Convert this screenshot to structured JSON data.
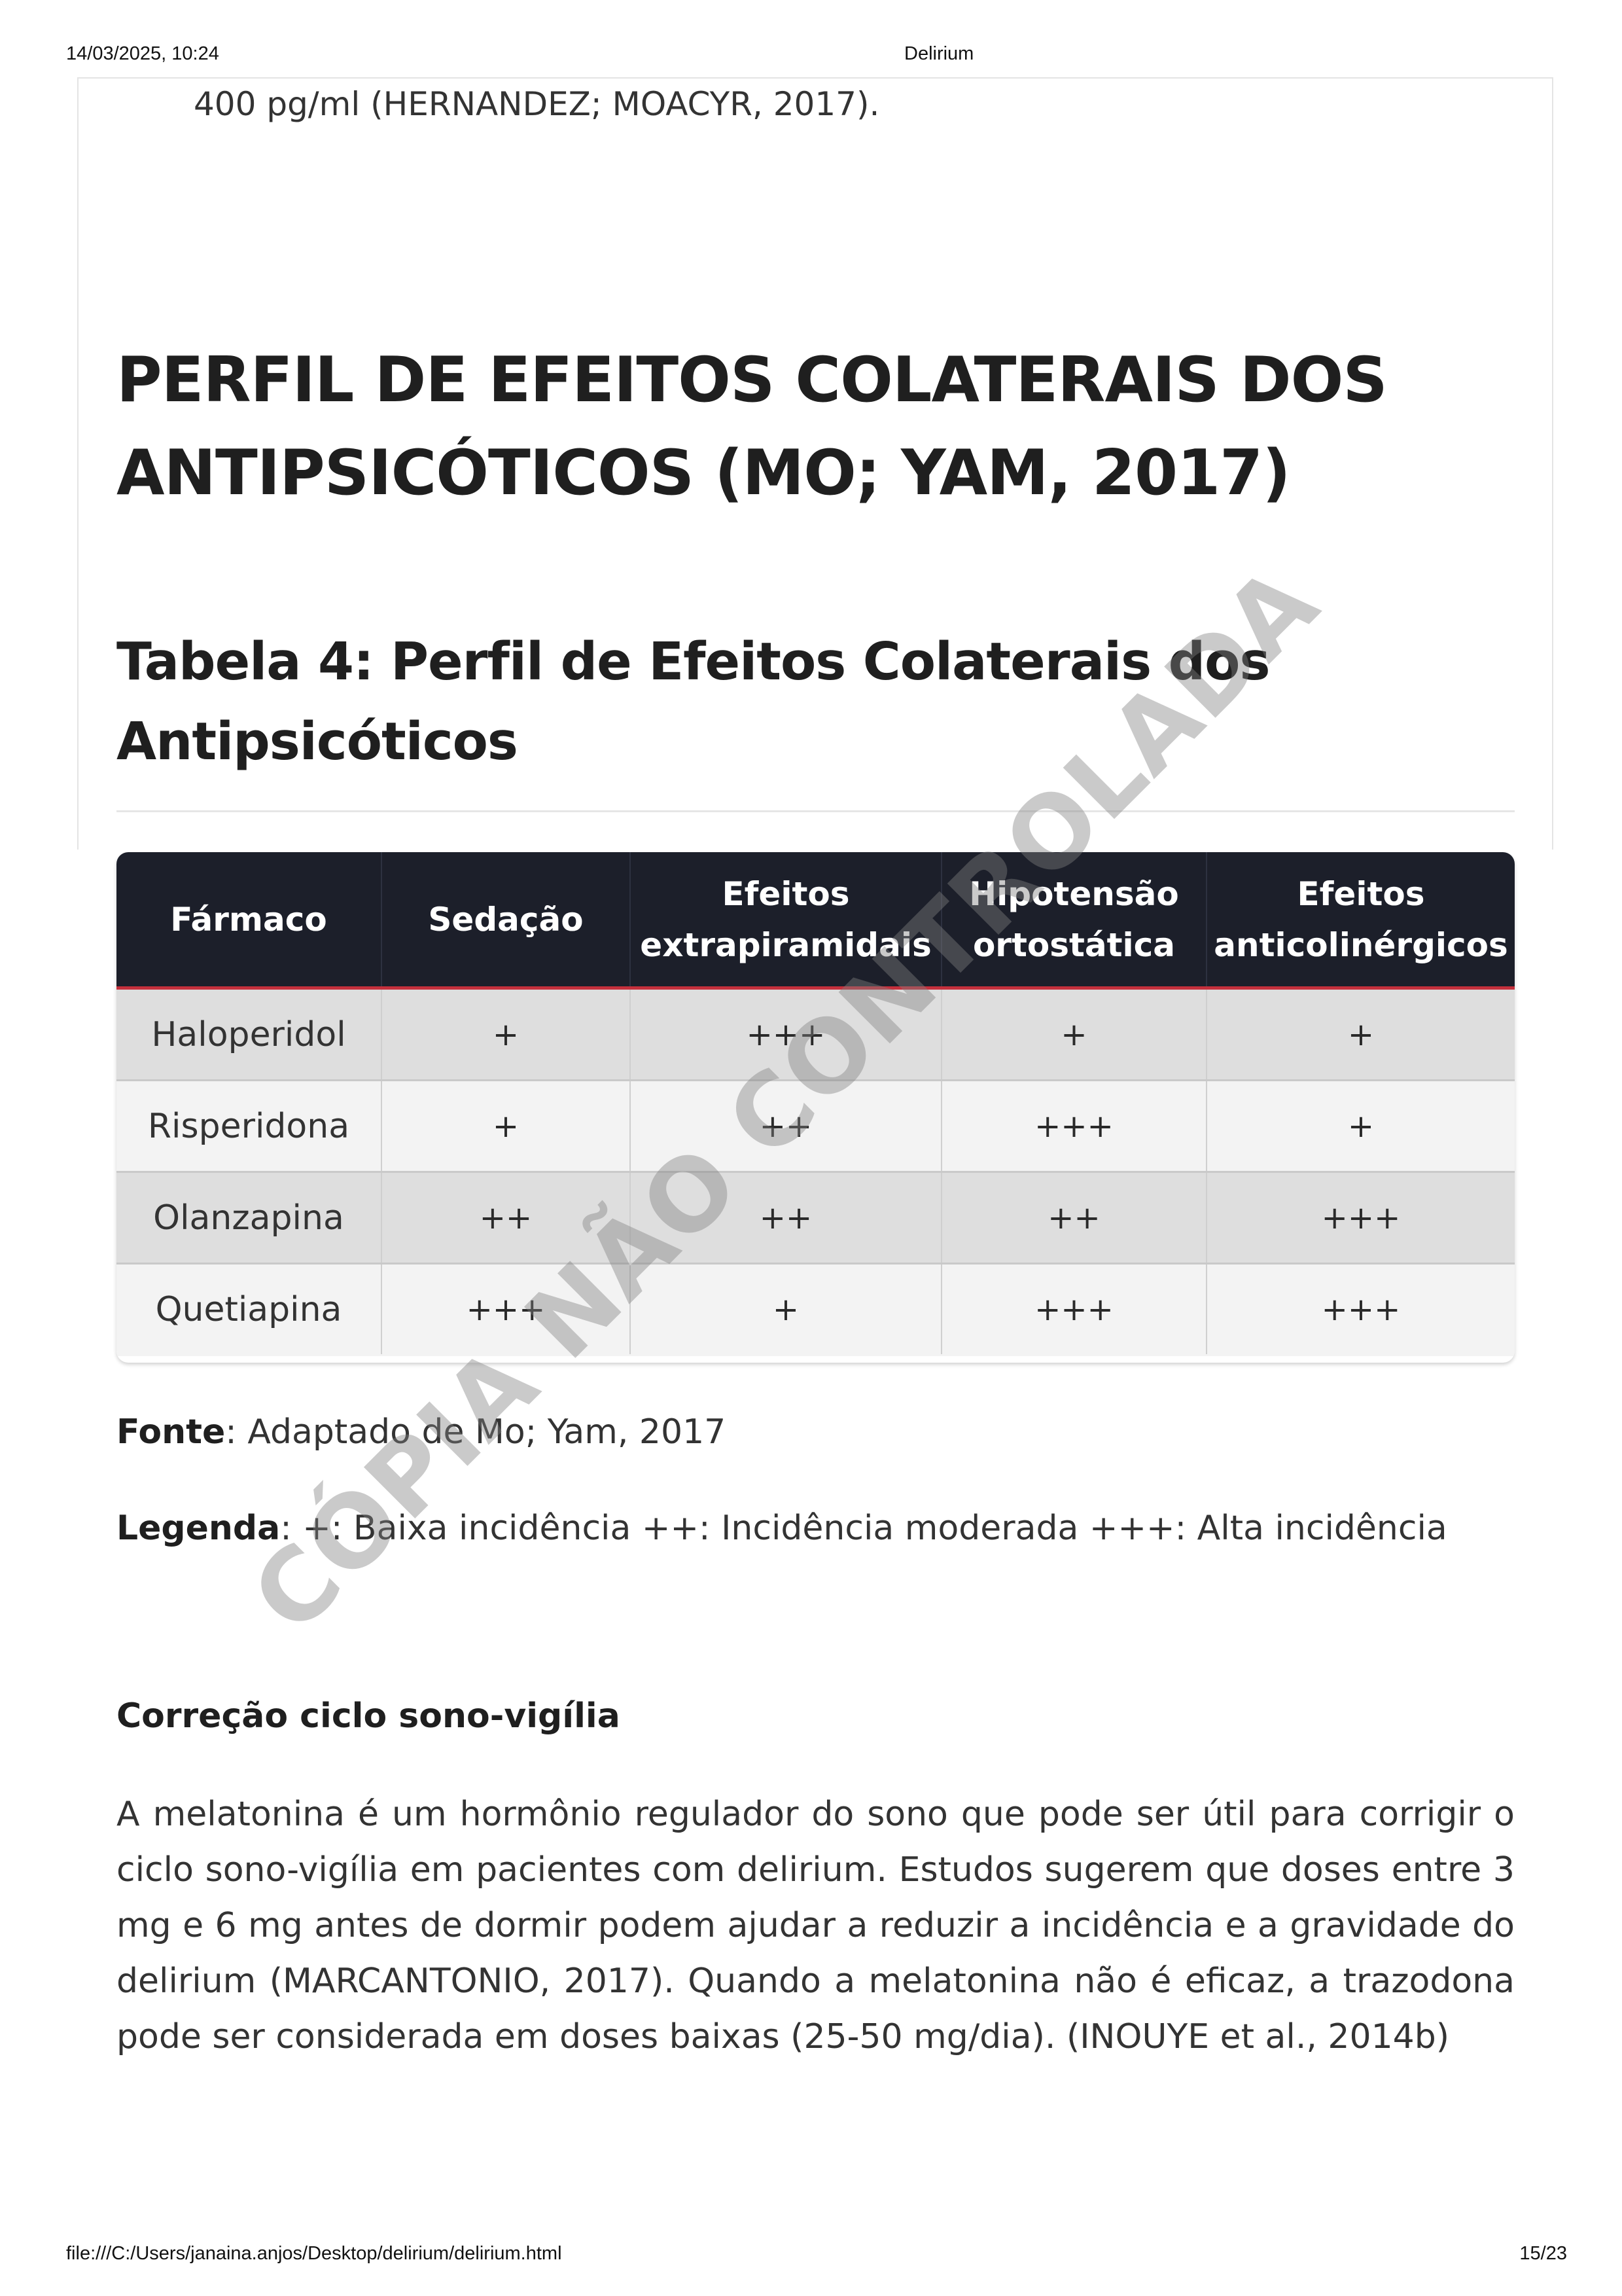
{
  "print_header": {
    "datetime": "14/03/2025, 10:24",
    "title": "Delirium"
  },
  "intro_text": "400 pg/ml (HERNANDEZ; MOACYR, 2017).",
  "section_heading": "PERFIL DE EFEITOS COLATERAIS DOS ANTIPSICÓTICOS (MO; YAM, 2017)",
  "table_heading": "Tabela 4: Perfil de Efeitos Colaterais dos Antipsicóticos",
  "table": {
    "headers": [
      "Fármaco",
      "Sedação",
      "Efeitos extrapiramidais",
      "Hipotensão ortostática",
      "Efeitos anticolinérgicos"
    ],
    "rows": [
      [
        "Haloperidol",
        "+",
        "+++",
        "+",
        "+"
      ],
      [
        "Risperidona",
        "+",
        "++",
        "+++",
        "+"
      ],
      [
        "Olanzapina",
        "++",
        "++",
        "++",
        "+++"
      ],
      [
        "Quetiapina",
        "+++",
        "+",
        "+++",
        "+++"
      ]
    ]
  },
  "source": {
    "label": "Fonte",
    "text": ": Adaptado de Mo; Yam, 2017"
  },
  "legend": {
    "label": "Legenda",
    "text": ": +: Baixa incidência ++: Incidência moderada +++: Alta incidência"
  },
  "subheading": "Correção ciclo sono-vigília",
  "paragraph": "A melatonina é um hormônio regulador do sono que pode ser útil para corrigir o ciclo sono-vigília em pacientes com delirium. Estudos sugerem que doses entre 3 mg e 6 mg antes de dormir podem ajudar a reduzir a incidência e a gravidade do delirium (MARCANTONIO, 2017). Quando a melatonina não é eficaz, a trazodona pode ser considerada em doses baixas (25-50 mg/dia). (INOUYE et al., 2014b)",
  "watermark": "CÓPIA NÃO CONTROLADA",
  "print_footer": {
    "path": "file:///C:/Users/janaina.anjos/Desktop/delirium/delirium.html",
    "page": "15/23"
  }
}
